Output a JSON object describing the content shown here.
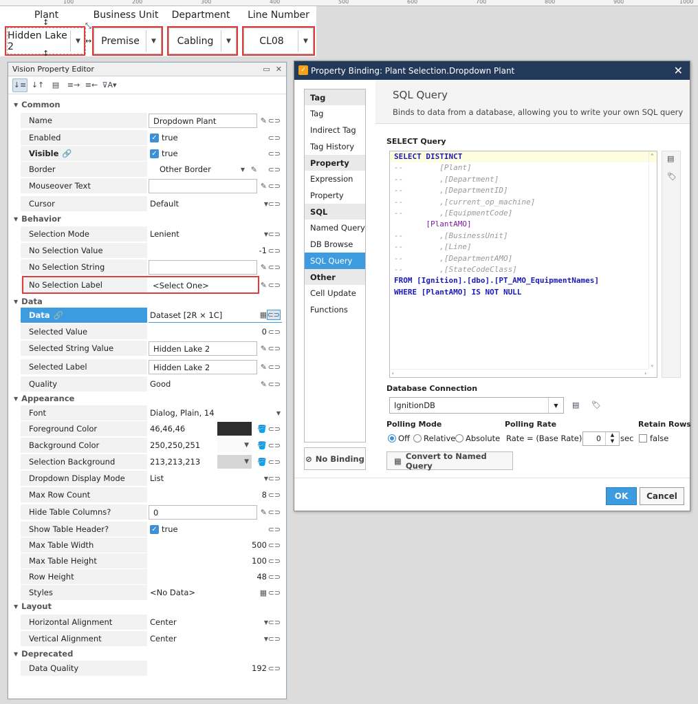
{
  "ruler": {
    "labels": [
      "100",
      "200",
      "300",
      "400",
      "500",
      "600",
      "700",
      "800",
      "900",
      "1000"
    ]
  },
  "canvas": {
    "headers": [
      "Plant",
      "Business Unit",
      "Department",
      "Line Number"
    ],
    "dropdowns": [
      "Hidden Lake 2",
      "Premise",
      "Cabling",
      "CL08"
    ]
  },
  "property_editor": {
    "title": "Vision Property Editor",
    "sections": {
      "common": "Common",
      "behavior": "Behavior",
      "data": "Data",
      "appearance": "Appearance",
      "layout": "Layout",
      "deprecated": "Deprecated"
    },
    "rows": {
      "name": {
        "label": "Name",
        "value": "Dropdown Plant"
      },
      "enabled": {
        "label": "Enabled",
        "value": "true"
      },
      "visible": {
        "label": "Visible",
        "value": "true"
      },
      "border": {
        "label": "Border",
        "value": "Other Border"
      },
      "mouseover": {
        "label": "Mouseover Text",
        "value": ""
      },
      "cursor": {
        "label": "Cursor",
        "value": "Default"
      },
      "selection_mode": {
        "label": "Selection Mode",
        "value": "Lenient"
      },
      "no_sel_value": {
        "label": "No Selection Value",
        "value": "-1"
      },
      "no_sel_string": {
        "label": "No Selection String",
        "value": ""
      },
      "no_sel_label": {
        "label": "No Selection Label",
        "value": "<Select One>"
      },
      "data": {
        "label": "Data",
        "value": "Dataset [2R ⨯ 1C]"
      },
      "selected_value": {
        "label": "Selected Value",
        "value": "0"
      },
      "selected_string": {
        "label": "Selected String Value",
        "value": "Hidden Lake 2"
      },
      "selected_label": {
        "label": "Selected Label",
        "value": "Hidden Lake 2"
      },
      "quality": {
        "label": "Quality",
        "value": "Good"
      },
      "font": {
        "label": "Font",
        "value": "Dialog, Plain, 14"
      },
      "fg": {
        "label": "Foreground Color",
        "value": "46,46,46",
        "color": "#2e2e2e"
      },
      "bg": {
        "label": "Background Color",
        "value": "250,250,251",
        "color": "#fafafb"
      },
      "selbg": {
        "label": "Selection Background",
        "value": "213,213,213",
        "color": "#d5d5d5"
      },
      "display_mode": {
        "label": "Dropdown Display Mode",
        "value": "List"
      },
      "max_rows": {
        "label": "Max Row Count",
        "value": "8"
      },
      "hide_cols": {
        "label": "Hide Table Columns?",
        "value": "0"
      },
      "show_header": {
        "label": "Show Table Header?",
        "value": "true"
      },
      "max_width": {
        "label": "Max Table Width",
        "value": "500"
      },
      "max_height": {
        "label": "Max Table Height",
        "value": "100"
      },
      "row_height": {
        "label": "Row Height",
        "value": "48"
      },
      "styles": {
        "label": "Styles",
        "value": "<No Data>"
      },
      "h_align": {
        "label": "Horizontal Alignment",
        "value": "Center"
      },
      "v_align": {
        "label": "Vertical Alignment",
        "value": "Center"
      },
      "data_quality": {
        "label": "Data Quality",
        "value": "192"
      }
    }
  },
  "dialog": {
    "title": "Property Binding: Plant Selection.Dropdown Plant",
    "nav": {
      "g_tag": "Tag",
      "tag": "Tag",
      "indirect_tag": "Indirect Tag",
      "tag_history": "Tag History",
      "g_property": "Property",
      "expression": "Expression",
      "property": "Property",
      "g_sql": "SQL",
      "named_query": "Named Query",
      "db_browse": "DB Browse",
      "sql_query": "SQL Query",
      "g_other": "Other",
      "cell_update": "Cell Update",
      "functions": "Functions"
    },
    "no_binding": "No Binding",
    "heading": "SQL Query",
    "description": "Binds to data from a database, allowing you to write your own SQL query",
    "select_query_label": "SELECT Query",
    "query_lines": [
      "SELECT DISTINCT",
      "--        [Plant]",
      "--        ,[Department]",
      "--        ,[DepartmentID]",
      "--        ,[current_op_machine]",
      "--        ,[EquipmentCode]",
      "       [PlantAMO]",
      "--        ,[BusinessUnit]",
      "--        ,[Line]",
      "--        ,[DepartmentAMO]",
      "--        ,[StateCodeClass]",
      "FROM [Ignition].[dbo].[PT_AMO_EquipmentNames]",
      "WHERE [PlantAMO] IS NOT NULL"
    ],
    "db_connection_label": "Database Connection",
    "db_connection": "IgnitionDB",
    "polling_mode_label": "Polling Mode",
    "polling_options": [
      "Off",
      "Relative",
      "Absolute"
    ],
    "polling_rate_label": "Polling Rate",
    "rate_text": "Rate = (Base Rate) +/-",
    "rate_value": "0",
    "rate_unit": "sec",
    "retain_rows_label": "Retain Rows",
    "retain_rows": "false",
    "convert_button": "Convert to Named Query",
    "ok": "OK",
    "cancel": "Cancel"
  }
}
